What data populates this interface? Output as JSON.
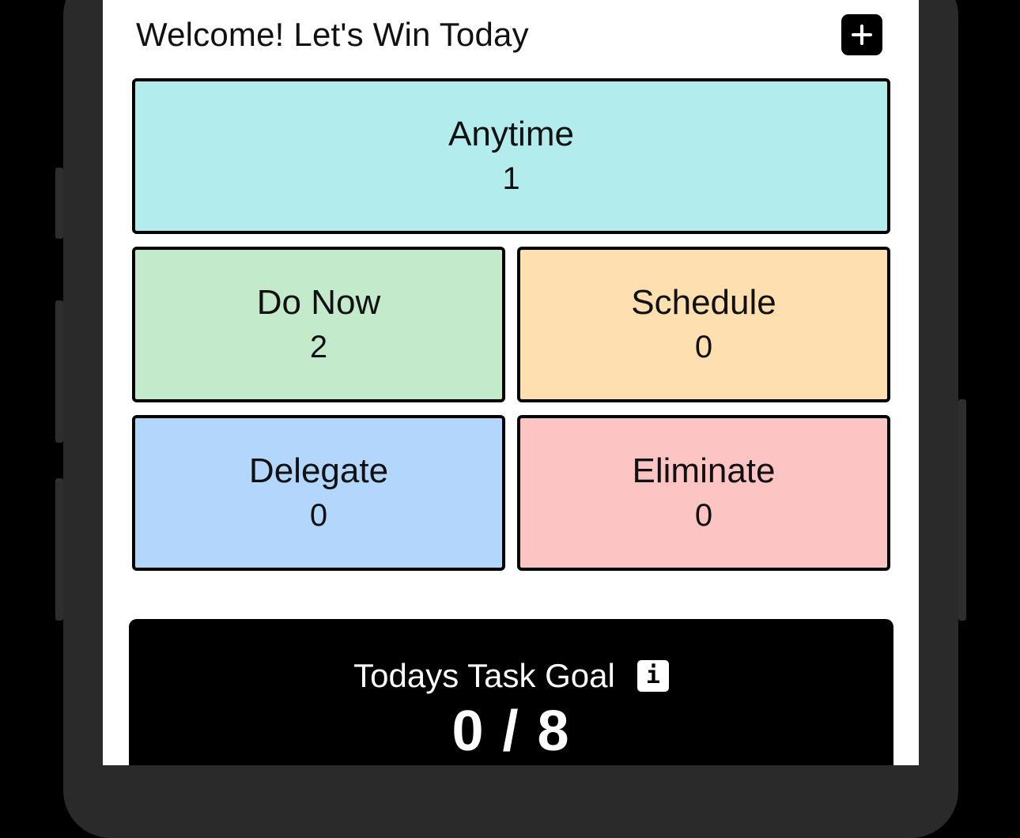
{
  "header": {
    "title": "Welcome! Let's Win Today",
    "add_icon": "plus-icon"
  },
  "quadrants": {
    "anytime": {
      "label": "Anytime",
      "count": "1",
      "color": "#b2ecec"
    },
    "do_now": {
      "label": "Do Now",
      "count": "2",
      "color": "#c3ebcb"
    },
    "schedule": {
      "label": "Schedule",
      "count": "0",
      "color": "#fddfb0"
    },
    "delegate": {
      "label": "Delegate",
      "count": "0",
      "color": "#b3d6fc"
    },
    "eliminate": {
      "label": "Eliminate",
      "count": "0",
      "color": "#fcc4c3"
    }
  },
  "goal": {
    "title": "Todays Task Goal",
    "info_icon": "info-icon",
    "info_glyph": "i",
    "value": "0 / 8"
  },
  "colors": {
    "screen_bg": "#ffffff",
    "device_bg": "#000000",
    "goal_card_bg": "#000000",
    "tile_border": "#000000"
  }
}
